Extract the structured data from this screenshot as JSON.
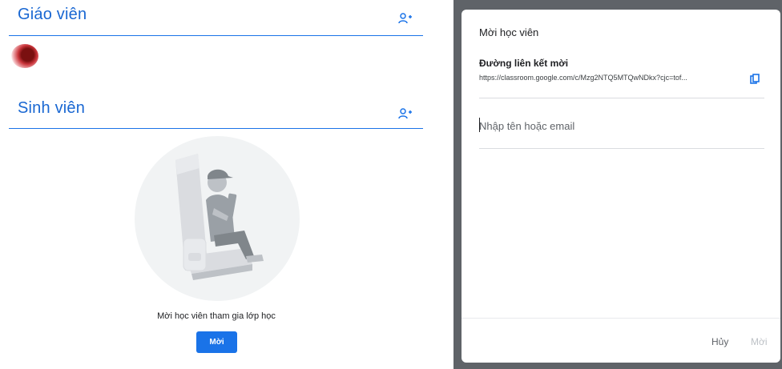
{
  "left_panel": {
    "teachers": {
      "title": "Giáo viên"
    },
    "students": {
      "title": "Sinh viên"
    },
    "empty_state": {
      "message": "Mời học viên tham gia lớp học",
      "invite_button": "Mời"
    }
  },
  "dialog": {
    "title": "Mời học viên",
    "invite_link_label": "Đường liên kết mời",
    "invite_link_url": "https://classroom.google.com/c/Mzg2NTQ5MTQwNDkx?cjc=tof...",
    "search_placeholder": "Nhập tên hoặc email",
    "cancel_label": "Hủy",
    "confirm_label": "Mời"
  },
  "colors": {
    "accent": "#1a73e8",
    "title_blue": "#1967d2",
    "overlay": "#5f6368"
  },
  "icons": [
    "add-person-icon",
    "copy-icon"
  ]
}
